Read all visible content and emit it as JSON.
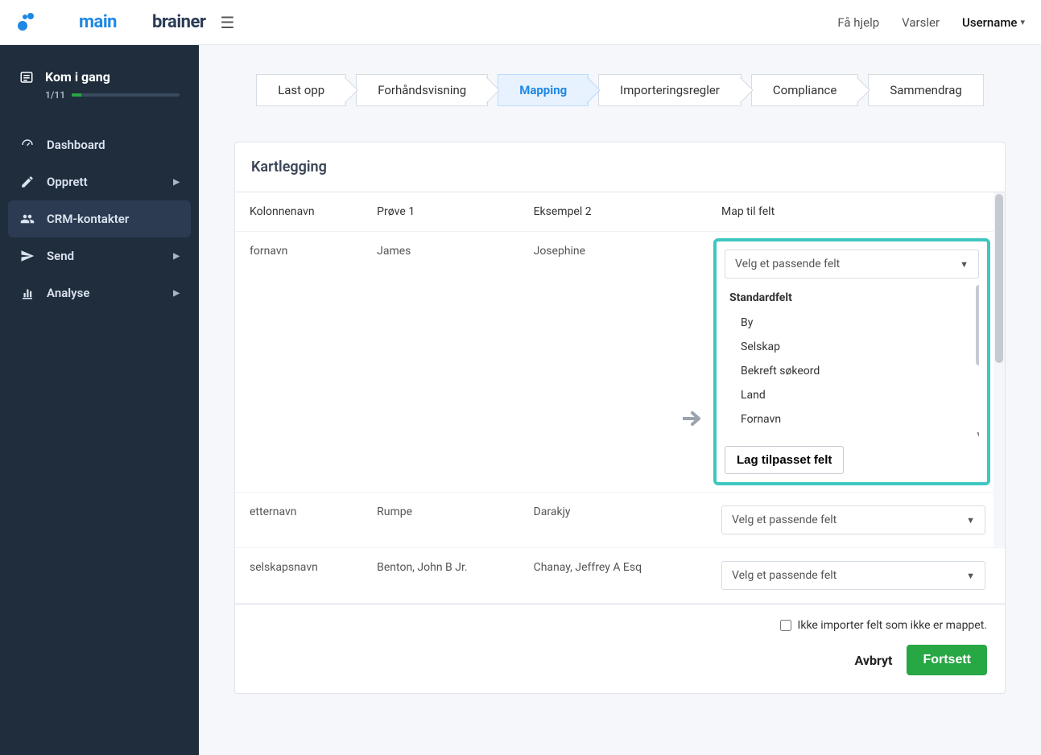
{
  "topbar": {
    "help": "Få hjelp",
    "alerts": "Varsler",
    "username": "Username"
  },
  "logo": {
    "part1": "main",
    "part2": "brainer"
  },
  "sidebar": {
    "onboarding": {
      "title": "Kom i gang",
      "progress_label": "1/11"
    },
    "items": [
      {
        "label": "Dashboard",
        "has_chevron": false
      },
      {
        "label": "Opprett",
        "has_chevron": true
      },
      {
        "label": "CRM-kontakter",
        "has_chevron": false,
        "active": true
      },
      {
        "label": "Send",
        "has_chevron": true
      },
      {
        "label": "Analyse",
        "has_chevron": true
      }
    ]
  },
  "stepper": {
    "steps": [
      "Last opp",
      "Forhåndsvisning",
      "Mapping",
      "Importeringsregler",
      "Compliance",
      "Sammendrag"
    ],
    "active_index": 2
  },
  "card": {
    "title": "Kartlegging",
    "columns": [
      "Kolonnenavn",
      "Prøve 1",
      "Eksempel 2",
      "Map til felt"
    ],
    "rows": [
      {
        "col": "fornavn",
        "s1": "James",
        "s2": "Josephine"
      },
      {
        "col": "etternavn",
        "s1": "Rumpe",
        "s2": "Darakjy"
      },
      {
        "col": "selskapsnavn",
        "s1": "Benton, John B Jr.",
        "s2": "Chanay, Jeffrey A Esq"
      }
    ],
    "select_placeholder": "Velg et passende felt",
    "dropdown": {
      "group_label": "Standardfelt",
      "options": [
        "By",
        "Selskap",
        "Bekreft søkeord",
        "Land",
        "Fornavn"
      ],
      "custom_button": "Lag tilpasset felt"
    },
    "footer_checkbox": "Ikke importer felt som ikke er mappet.",
    "cancel": "Avbryt",
    "continue": "Fortsett"
  }
}
